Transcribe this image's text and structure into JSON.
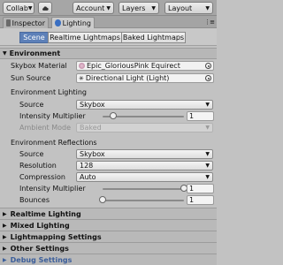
{
  "toolbar": {
    "collab": "Collab",
    "account": "Account",
    "layers": "Layers",
    "layout": "Layout"
  },
  "tabs": [
    {
      "label": "Inspector",
      "active": false
    },
    {
      "label": "Lighting",
      "active": true
    }
  ],
  "subtabs": [
    "Scene",
    "Realtime Lightmaps",
    "Baked Lightmaps"
  ],
  "environment": {
    "header": "Environment",
    "skybox_material_label": "Skybox Material",
    "skybox_material_value": "Epic_GloriousPink Equirect",
    "sun_source_label": "Sun Source",
    "sun_source_value": "Directional Light (Light)",
    "env_lighting_label": "Environment Lighting",
    "source_label": "Source",
    "source_value": "Skybox",
    "intensity_label": "Intensity Multiplier",
    "intensity_value": "1",
    "intensity_fraction": 0.125,
    "ambient_mode_label": "Ambient Mode",
    "ambient_mode_value": "Baked",
    "env_reflections_label": "Environment Reflections",
    "refl_source_label": "Source",
    "refl_source_value": "Skybox",
    "resolution_label": "Resolution",
    "resolution_value": "128",
    "compression_label": "Compression",
    "compression_value": "Auto",
    "refl_intensity_label": "Intensity Multiplier",
    "refl_intensity_value": "1",
    "refl_intensity_fraction": 1.0,
    "bounces_label": "Bounces",
    "bounces_value": "1",
    "bounces_fraction": 0.0
  },
  "collapsed_sections": [
    "Realtime Lighting",
    "Mixed Lighting",
    "Lightmapping Settings",
    "Other Settings",
    "Debug Settings"
  ],
  "icons": {
    "collab": "cloud-icon",
    "inspector": "inspector-icon",
    "lighting": "lighting-icon"
  },
  "colors": {
    "accent": "#5d80b8",
    "debug_header": "#3c5f9b"
  }
}
